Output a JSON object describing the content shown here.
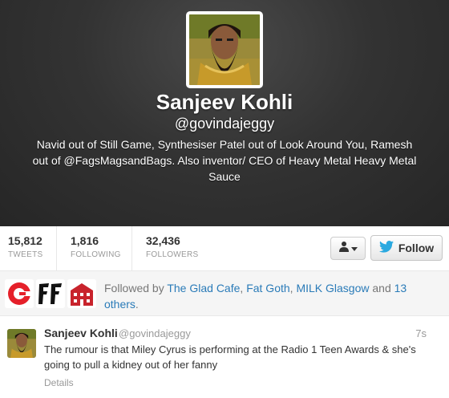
{
  "profile": {
    "name": "Sanjeev Kohli",
    "handle": "@govindajeggy",
    "bio": "Navid out of Still Game, Synthesiser Patel out of Look Around You, Ramesh out of @FagsMagsandBags. Also inventor/ CEO of Heavy Metal Heavy Metal Sauce"
  },
  "stats": [
    {
      "value": "15,812",
      "label": "TWEETS"
    },
    {
      "value": "1,816",
      "label": "FOLLOWING"
    },
    {
      "value": "32,436",
      "label": "FOLLOWERS"
    }
  ],
  "actions": {
    "user_menu_icon": "person-dropdown-icon",
    "follow_label": "Follow",
    "follow_icon": "bird-icon"
  },
  "followed_by": {
    "prefix": "Followed by",
    "names": [
      "The Glad Cafe",
      "Fat Goth",
      "MILK Glasgow"
    ],
    "sep1": ",",
    "sep2": ",",
    "and": "and",
    "others": "13 others",
    "end": "."
  },
  "tweet": {
    "name": "Sanjeev Kohli",
    "handle": "@govindajeggy",
    "time": "7s",
    "text": "The rumour is that Miley Cyrus is performing at the Radio 1 Teen Awards & she's going to pull a kidney out of her fanny",
    "details": "Details"
  },
  "colors": {
    "link": "#2a7bb8",
    "twitter_blue": "#2aa9e0",
    "header_bg": "#333333",
    "glad_cafe_red": "#e5202a",
    "milk_red": "#c8232c"
  }
}
